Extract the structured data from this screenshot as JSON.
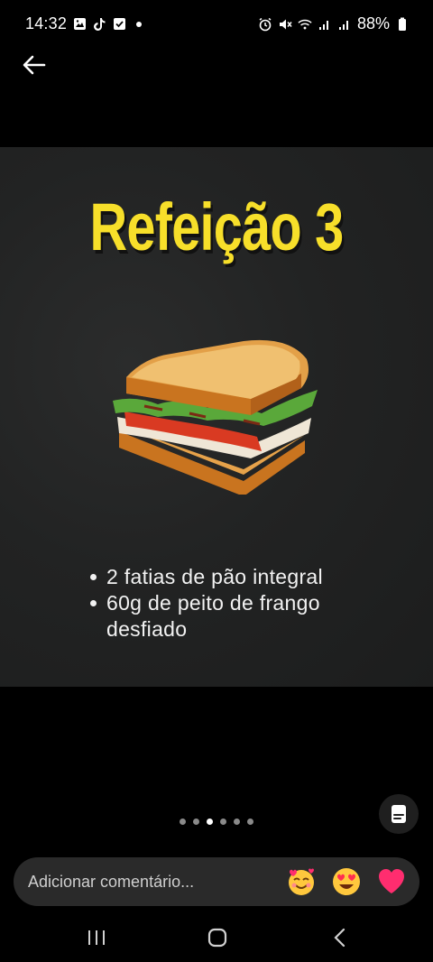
{
  "status_bar": {
    "time": "14:32",
    "battery": "88%",
    "left_icons": [
      "gallery-icon",
      "tiktok-icon",
      "checkbox-icon",
      "dot-icon"
    ],
    "right_icons": [
      "alarm-icon",
      "mute-icon",
      "wifi-icon",
      "signal-icon",
      "signal-icon",
      "battery-icon"
    ]
  },
  "post": {
    "title": "Refeição 3",
    "ingredients": [
      "2 fatias de pão integral",
      "60g de peito de frango desfiado"
    ],
    "title_color": "#f7df2a"
  },
  "carousel": {
    "total": 6,
    "active_index": 2
  },
  "comment": {
    "placeholder": "Adicionar comentário...",
    "reactions": [
      "smiling-face-with-hearts-icon",
      "heart-eyes-icon",
      "heart-icon"
    ]
  },
  "colors": {
    "accent_yellow": "#f7df2a",
    "heart_pink": "#ff2d6f"
  }
}
